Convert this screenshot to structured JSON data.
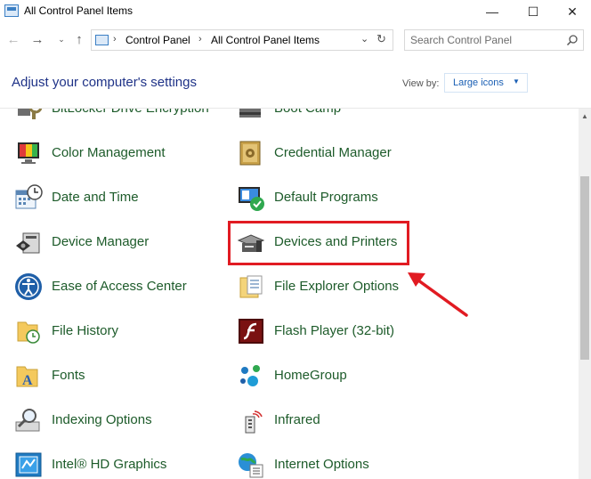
{
  "window": {
    "title": "All Control Panel Items",
    "minimize": "—",
    "maximize": "☐",
    "close": "✕"
  },
  "nav": {
    "back": "←",
    "forward": "→",
    "recent": "⌄",
    "up": "↑",
    "refresh": "↻",
    "drop": "⌄",
    "sep": "›"
  },
  "address": {
    "crumbs": [
      "Control Panel",
      "All Control Panel Items"
    ]
  },
  "search": {
    "placeholder": "Search Control Panel"
  },
  "header": {
    "title": "Adjust your computer's settings",
    "view_by_label": "View by:",
    "view_by_value": "Large icons",
    "arrow": "▼"
  },
  "scrollbar": {
    "up": "▲"
  },
  "items": {
    "left": [
      {
        "label": "BitLocker Drive Encryption",
        "icon": "bitlocker-icon"
      },
      {
        "label": "Color Management",
        "icon": "color-management-icon"
      },
      {
        "label": "Date and Time",
        "icon": "date-time-icon"
      },
      {
        "label": "Device Manager",
        "icon": "device-manager-icon"
      },
      {
        "label": "Ease of Access Center",
        "icon": "ease-of-access-icon"
      },
      {
        "label": "File History",
        "icon": "file-history-icon"
      },
      {
        "label": "Fonts",
        "icon": "fonts-icon"
      },
      {
        "label": "Indexing Options",
        "icon": "indexing-icon"
      },
      {
        "label": "Intel® HD Graphics",
        "icon": "intel-graphics-icon"
      }
    ],
    "right": [
      {
        "label": "Boot Camp",
        "icon": "boot-camp-icon"
      },
      {
        "label": "Credential Manager",
        "icon": "credential-manager-icon"
      },
      {
        "label": "Default Programs",
        "icon": "default-programs-icon"
      },
      {
        "label": "Devices and Printers",
        "icon": "devices-printers-icon"
      },
      {
        "label": "File Explorer Options",
        "icon": "file-explorer-options-icon"
      },
      {
        "label": "Flash Player (32-bit)",
        "icon": "flash-player-icon"
      },
      {
        "label": "HomeGroup",
        "icon": "homegroup-icon"
      },
      {
        "label": "Infrared",
        "icon": "infrared-icon"
      },
      {
        "label": "Internet Options",
        "icon": "internet-options-icon"
      }
    ]
  },
  "annotation": {
    "highlight_color": "#e11b22",
    "highlighted_item": "Devices and Printers"
  },
  "colors": {
    "link": "#1d5b2a",
    "title": "#1e3287",
    "accent": "#1a5fb4"
  }
}
